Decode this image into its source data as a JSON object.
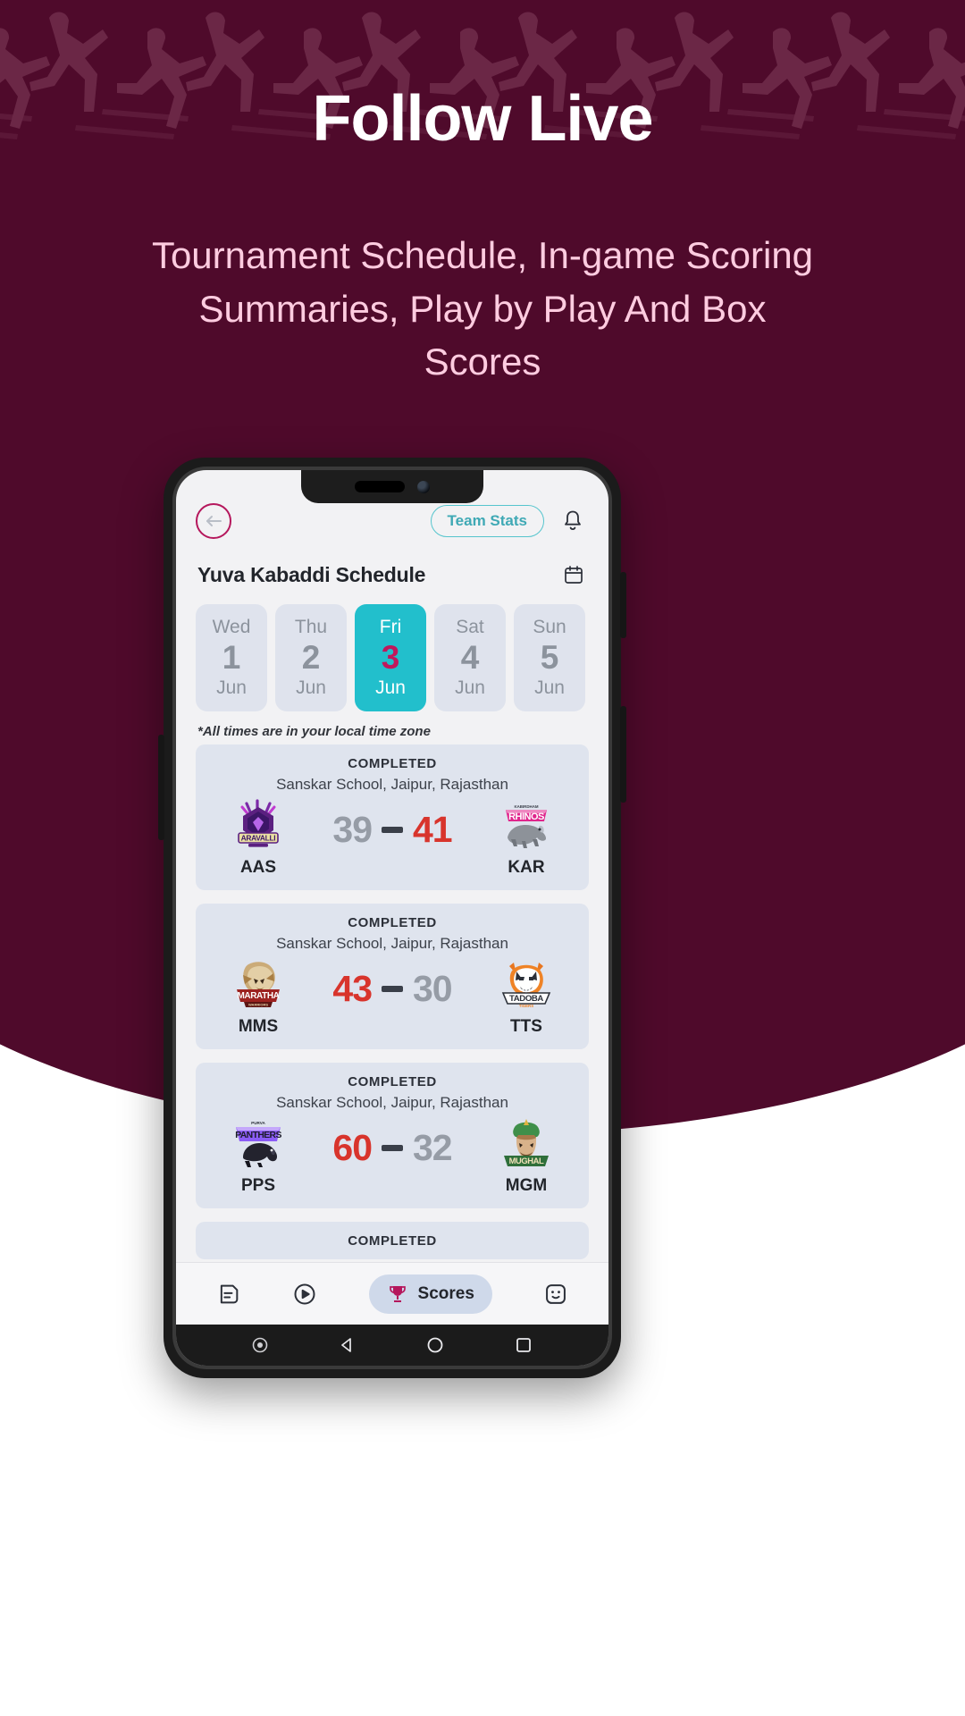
{
  "hero": {
    "title": "Follow Live",
    "subtitle": "Tournament Schedule, In-game Scoring Summaries, Play by Play And Box Scores",
    "bg_color": "#4f0a2b",
    "title_color": "#ffffff",
    "subtitle_color": "#ffcce0"
  },
  "app": {
    "topbar": {
      "back_icon": "back-arrow-icon",
      "team_stats_label": "Team Stats",
      "team_stats_color": "#3fa9b5",
      "bell_icon": "bell-icon"
    },
    "schedule": {
      "title": "Yuva Kabaddi Schedule",
      "calendar_icon": "calendar-icon",
      "timezone_note": "*All times are in your local time zone",
      "accent_active": "#22bfcc",
      "accent_date": "#c0185c"
    },
    "dates": [
      {
        "dow": "Wed",
        "day": "1",
        "month": "Jun",
        "selected": false
      },
      {
        "dow": "Thu",
        "day": "2",
        "month": "Jun",
        "selected": false
      },
      {
        "dow": "Fri",
        "day": "3",
        "month": "Jun",
        "selected": true
      },
      {
        "dow": "Sat",
        "day": "4",
        "month": "Jun",
        "selected": false
      },
      {
        "dow": "Sun",
        "day": "5",
        "month": "Jun",
        "selected": false
      }
    ],
    "matches": [
      {
        "status": "COMPLETED",
        "venue": "Sanskar School, Jaipur, Rajasthan",
        "home": {
          "code": "AAS",
          "logo": "aravalli-logo"
        },
        "away": {
          "code": "KAR",
          "logo": "rhinos-logo"
        },
        "home_score": "39",
        "away_score": "41",
        "winner": "away"
      },
      {
        "status": "COMPLETED",
        "venue": "Sanskar School, Jaipur, Rajasthan",
        "home": {
          "code": "MMS",
          "logo": "maratha-logo"
        },
        "away": {
          "code": "TTS",
          "logo": "tadoba-logo"
        },
        "home_score": "43",
        "away_score": "30",
        "winner": "home"
      },
      {
        "status": "COMPLETED",
        "venue": "Sanskar School, Jaipur, Rajasthan",
        "home": {
          "code": "PPS",
          "logo": "panthers-logo"
        },
        "away": {
          "code": "MGM",
          "logo": "mughal-logo"
        },
        "home_score": "60",
        "away_score": "32",
        "winner": "home"
      }
    ],
    "partial_match": {
      "status": "COMPLETED"
    },
    "bottom_nav": [
      {
        "icon": "feed-icon",
        "label": "",
        "active": false
      },
      {
        "icon": "play-icon",
        "label": "",
        "active": false
      },
      {
        "icon": "trophy-icon",
        "label": "Scores",
        "active": true
      },
      {
        "icon": "profile-icon",
        "label": "",
        "active": false
      }
    ],
    "system_nav": [
      {
        "icon": "assistant-dot-icon"
      },
      {
        "icon": "back-triangle-icon"
      },
      {
        "icon": "home-circle-icon"
      },
      {
        "icon": "recents-square-icon"
      }
    ]
  }
}
